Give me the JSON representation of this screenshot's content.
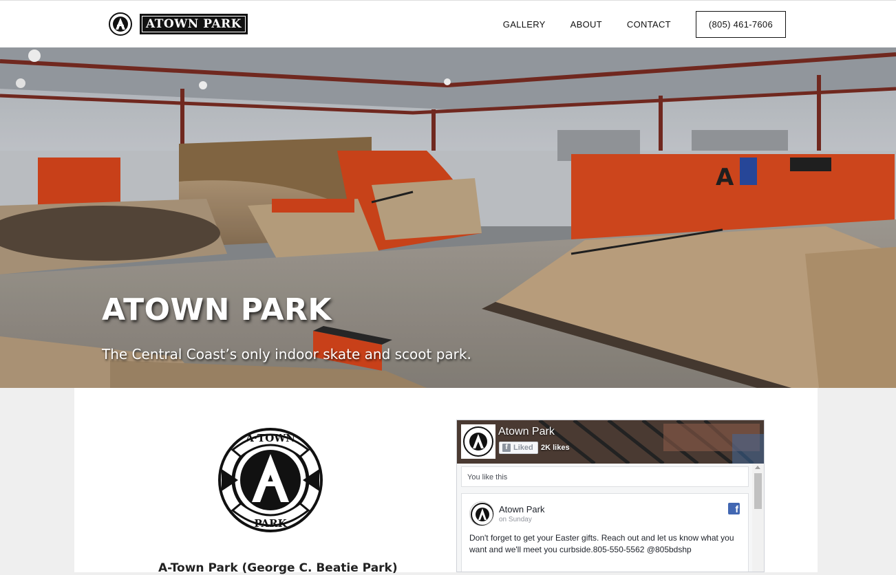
{
  "header": {
    "logo_text": "ATOWN PARK",
    "logo_icon": "atown-emblem-icon",
    "nav": [
      "GALLERY",
      "ABOUT",
      "CONTACT"
    ],
    "phone": "(805) 461-7606"
  },
  "hero": {
    "title": "ATOWN PARK",
    "subtitle": "The Central Coast’s only indoor skate and scoot park."
  },
  "about": {
    "emblem_top": "A·TOWN",
    "emblem_bottom": "PARK",
    "park_name": "A-Town Park (George C. Beatie Park)"
  },
  "facebook": {
    "page_name": "Atown Park",
    "liked_label": "Liked",
    "likes": "2K likes",
    "you_like": "You like this",
    "post": {
      "author": "Atown Park",
      "time": "on Sunday",
      "text": "Don't forget to get your Easter gifts. Reach out and let us know what you want and we'll meet you curbside.805-550-5562 @805bdshp"
    }
  },
  "colors": {
    "accent_orange": "#e04a1e",
    "fb_blue": "#4267b2"
  }
}
